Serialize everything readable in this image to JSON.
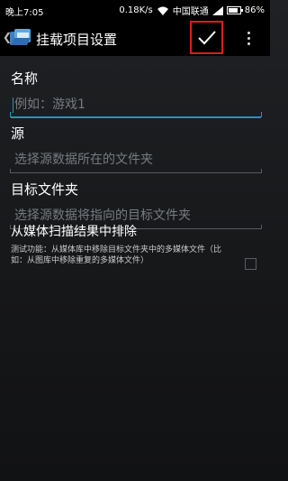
{
  "status_bar": {
    "time": "晚上7:05",
    "speed": "0.18K/s",
    "carrier": "中国联通",
    "battery": "86%",
    "battery_level": 0.86
  },
  "action_bar": {
    "title": "挂载项目设置",
    "back_icon": "chevron-left-icon",
    "app_icon": "folder-mount-icon",
    "confirm_icon": "checkmark-icon",
    "overflow_icon": "more-vertical-icon",
    "highlight_color": "#e01b1b"
  },
  "form": {
    "name": {
      "label": "名称",
      "placeholder": "例如：游戏1",
      "value": ""
    },
    "source": {
      "label": "源",
      "placeholder": "选择源数据所在的文件夹",
      "value": ""
    },
    "target": {
      "label": "目标文件夹",
      "placeholder": "选择源数据将指向的目标文件夹",
      "value": ""
    },
    "exclude": {
      "title": "从媒体扫描结果中排除",
      "description": "测试功能：从媒体库中移除目标文件夹中的多媒体文件（比如：从图库中移除重复的多媒体文件）",
      "checked": false
    }
  },
  "colors": {
    "accent": "#2f8fbd",
    "background": "#1a1b1d"
  }
}
